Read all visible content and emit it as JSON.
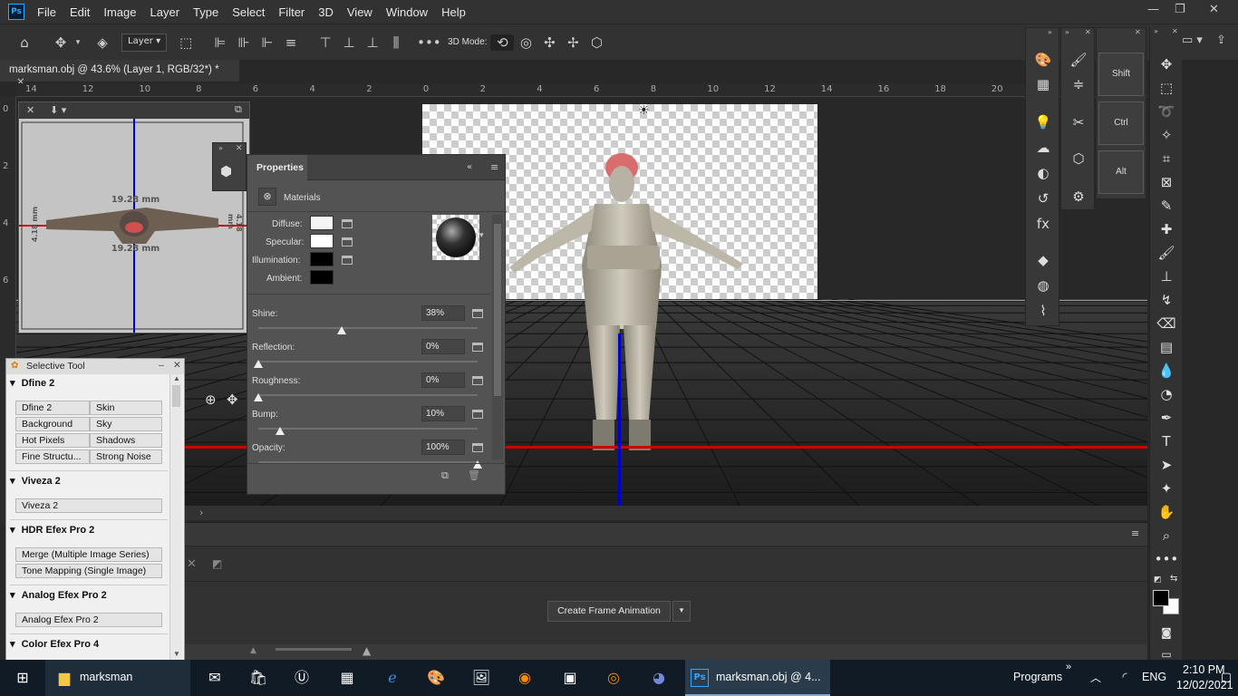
{
  "menubar": {
    "app_icon_label": "Ps",
    "items": [
      "File",
      "Edit",
      "Image",
      "Layer",
      "Type",
      "Select",
      "Filter",
      "3D",
      "View",
      "Window",
      "Help"
    ]
  },
  "options_bar": {
    "layer_select": "Layer",
    "mode_label": "3D Mode:"
  },
  "document": {
    "tab_title": "marksman.obj @ 43.6% (Layer 1, RGB/32*) *"
  },
  "ruler": {
    "top_ticks": [
      "14",
      "12",
      "10",
      "8",
      "6",
      "4",
      "2",
      "0",
      "2",
      "4",
      "6",
      "8",
      "10",
      "12",
      "14",
      "16",
      "18",
      "20"
    ],
    "left_ticks": [
      "0",
      "2",
      "4",
      "6"
    ]
  },
  "secondary_view": {
    "dimension_top": "19.28 mm",
    "dimension_bottom": "19.28 mm",
    "dimension_left": "4.18 mm",
    "dimension_right": "4.18 mm"
  },
  "properties": {
    "tab_title": "Properties",
    "section_label": "Materials",
    "diffuse_label": "Diffuse:",
    "specular_label": "Specular:",
    "illumination_label": "Illumination:",
    "ambient_label": "Ambient:",
    "colors": {
      "diffuse": "#f5f5f5",
      "specular": "#ffffff",
      "illumination": "#000000",
      "ambient": "#000000"
    },
    "sliders": [
      {
        "label": "Shine:",
        "value": "38%",
        "fraction": 0.38
      },
      {
        "label": "Reflection:",
        "value": "0%",
        "fraction": 0.0
      },
      {
        "label": "Roughness:",
        "value": "0%",
        "fraction": 0.0
      },
      {
        "label": "Bump:",
        "value": "10%",
        "fraction": 0.1
      },
      {
        "label": "Opacity:",
        "value": "100%",
        "fraction": 1.0
      }
    ]
  },
  "selective_tool": {
    "title": "Selective Tool",
    "groups": [
      {
        "name": "Dfine 2",
        "buttons": [
          "Dfine 2",
          "Skin",
          "Background",
          "Sky",
          "Hot Pixels",
          "Shadows",
          "Fine Structu...",
          "Strong Noise"
        ]
      },
      {
        "name": "Viveza 2",
        "buttons": [
          "Viveza 2"
        ]
      },
      {
        "name": "HDR Efex Pro 2",
        "buttons": [
          "Merge (Multiple Image Series)",
          "Tone Mapping (Single Image)"
        ]
      },
      {
        "name": "Analog Efex Pro 2",
        "buttons": [
          "Analog Efex Pro 2"
        ]
      },
      {
        "name": "Color Efex Pro 4",
        "buttons": []
      }
    ]
  },
  "timeline": {
    "create_button": "Create Frame Animation"
  },
  "modifier_keys": [
    "Shift",
    "Ctrl",
    "Alt"
  ],
  "taskbar": {
    "folder_label": "marksman",
    "ps_label": "marksman.obj @ 4...",
    "programs_label": "Programs",
    "language": "ENG",
    "time": "2:10 PM",
    "date": "12/02/2021"
  }
}
